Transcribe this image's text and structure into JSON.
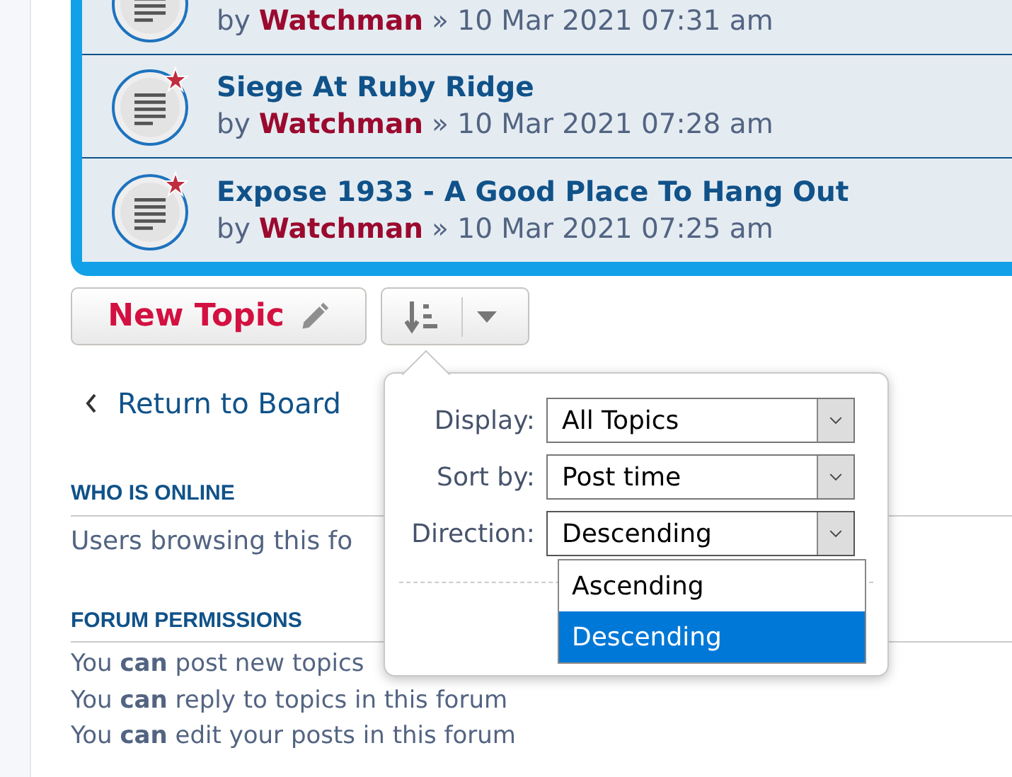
{
  "topics": [
    {
      "by": "by",
      "author": "Watchman",
      "date": "» 10 Mar 2021 07:31 am"
    },
    {
      "title": "Siege At Ruby Ridge",
      "by": "by",
      "author": "Watchman",
      "date": "» 10 Mar 2021 07:28 am",
      "unread": true
    },
    {
      "title": "Expose 1933 - A Good Place To Hang Out",
      "by": "by",
      "author": "Watchman",
      "date": "» 10 Mar 2021 07:25 am",
      "unread": true
    }
  ],
  "new_topic_button": {
    "label": "New Topic"
  },
  "return_link": "Return to Board",
  "who_is_online": {
    "heading": "WHO IS ONLINE",
    "text": "Users browsing this fo"
  },
  "forum_permissions": {
    "heading": "FORUM PERMISSIONS",
    "lines": [
      "You **can** post new topics",
      "You **can** reply to topics in this forum",
      "You **can** edit your posts in this forum"
    ]
  },
  "sort_popup": {
    "fields": [
      {
        "label": "Display:",
        "value": "All Topics",
        "expanded": false
      },
      {
        "label": "Sort by:",
        "value": "Post time",
        "expanded": false
      },
      {
        "label": "Direction:",
        "value": "Descending",
        "expanded": true
      }
    ],
    "options": [
      {
        "label": "Ascending",
        "selected": false
      },
      {
        "label": "Descending",
        "selected": true
      }
    ]
  }
}
